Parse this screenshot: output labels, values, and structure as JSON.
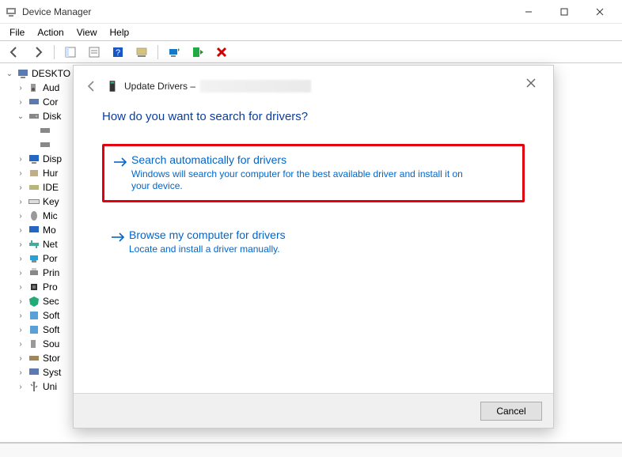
{
  "window": {
    "title": "Device Manager"
  },
  "menu": {
    "file": "File",
    "action": "Action",
    "view": "View",
    "help": "Help"
  },
  "tree": {
    "root": "DESKTO",
    "items": [
      {
        "label": "Aud"
      },
      {
        "label": "Cor"
      },
      {
        "label": "Disk",
        "expanded": true
      },
      {
        "label": "Disp"
      },
      {
        "label": "Hur"
      },
      {
        "label": "IDE"
      },
      {
        "label": "Key"
      },
      {
        "label": "Mic"
      },
      {
        "label": "Mo"
      },
      {
        "label": "Net"
      },
      {
        "label": "Por"
      },
      {
        "label": "Prin"
      },
      {
        "label": "Pro"
      },
      {
        "label": "Sec"
      },
      {
        "label": "Soft"
      },
      {
        "label": "Soft"
      },
      {
        "label": "Sou"
      },
      {
        "label": "Stor"
      },
      {
        "label": "Syst"
      },
      {
        "label": "Uni"
      }
    ]
  },
  "dialog": {
    "heading": "Update Drivers –",
    "question": "How do you want to search for drivers?",
    "option1": {
      "title": "Search automatically for drivers",
      "desc": "Windows will search your computer for the best available driver and install it on your device."
    },
    "option2": {
      "title": "Browse my computer for drivers",
      "desc": "Locate and install a driver manually."
    },
    "cancel": "Cancel"
  }
}
